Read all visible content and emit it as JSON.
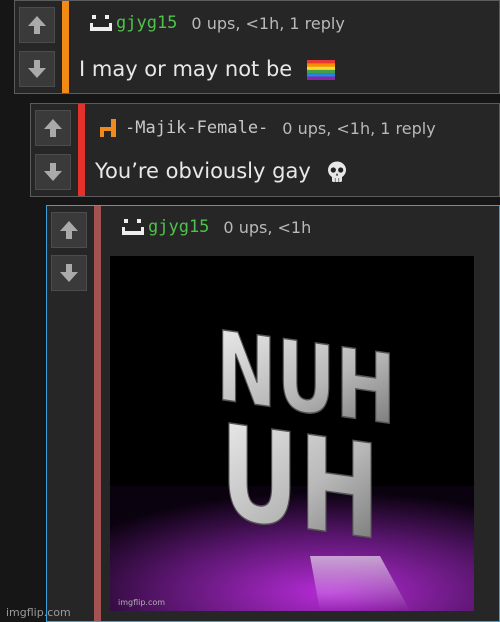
{
  "comments": [
    {
      "username": "gjyg15",
      "meta": "0 ups, <1h, 1 reply",
      "text": "I may or may not be",
      "emoji": "rainbow-flag",
      "bar_color": "#f28a16"
    },
    {
      "username": "-Majik-Female-",
      "meta": "0 ups, <1h, 1 reply",
      "text": "You’re obviously gay",
      "emoji": "skull",
      "bar_color": "#e3322b"
    },
    {
      "username": "gjyg15",
      "meta": "0 ups, <1h",
      "image_text": [
        "NUH",
        "UH"
      ],
      "image_watermark": "imgflip.com",
      "bar_color": "#a35252",
      "border_color": "#3aa0d8"
    }
  ],
  "watermark": "imgflip.com",
  "colors": {
    "background": "#161616",
    "comment_bg": "#262626",
    "username_green": "#4fc24b"
  },
  "icons": [
    "upvote-arrow-icon",
    "downvote-arrow-icon",
    "avatar-icon"
  ]
}
